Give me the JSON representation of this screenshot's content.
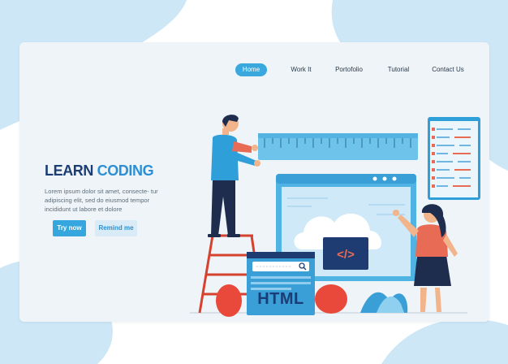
{
  "nav": {
    "items": [
      {
        "label": "Home",
        "active": true
      },
      {
        "label": "Work It",
        "active": false
      },
      {
        "label": "Portofolio",
        "active": false
      },
      {
        "label": "Tutorial",
        "active": false
      },
      {
        "label": "Contact Us",
        "active": false
      }
    ]
  },
  "hero": {
    "title_part1": "LEARN",
    "title_part2": "CODING",
    "description": "Lorem ipsum dolor sit amet, consecte- tur adipiscing elit, sed do eiusmod tempor incididunt ut labore et dolore",
    "primary_button": "Try now",
    "secondary_button": "Remind me"
  },
  "illustration": {
    "html_label": "HTML",
    "code_symbol": "</>"
  },
  "colors": {
    "accent": "#3aa8dd",
    "title_dark": "#1b3c74",
    "title_blue": "#2b8fd6",
    "background_blob": "#cde7f6",
    "card": "#eef4f8"
  }
}
